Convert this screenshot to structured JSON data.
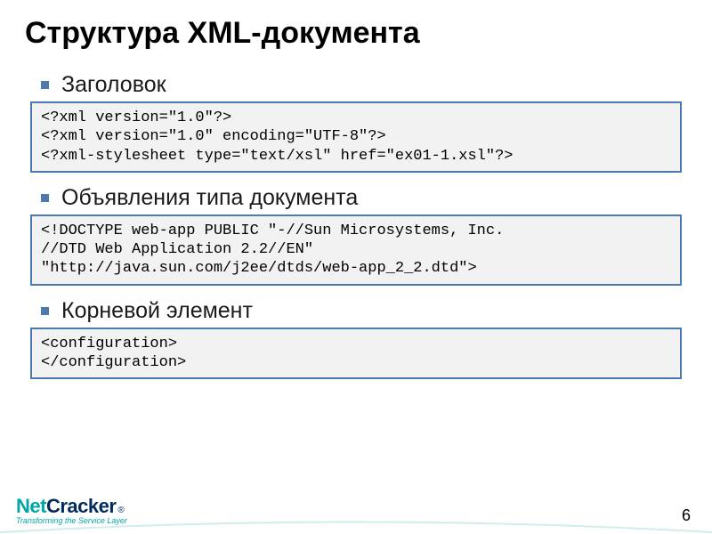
{
  "title": "Структура XML-документа",
  "sections": [
    {
      "label": "Заголовок",
      "code": "<?xml version=\"1.0\"?>\n<?xml version=\"1.0\" encoding=\"UTF-8\"?>\n<?xml-stylesheet type=\"text/xsl\" href=\"ex01-1.xsl\"?>"
    },
    {
      "label": "Объявления типа документа",
      "code": "<!DOCTYPE web-app PUBLIC \"-//Sun Microsystems, Inc.\n//DTD Web Application 2.2//EN\"\n\"http://java.sun.com/j2ee/dtds/web-app_2_2.dtd\">"
    },
    {
      "label": "Корневой элемент",
      "code": "<configuration>\n</configuration>"
    }
  ],
  "footer": {
    "logo_net": "Net",
    "logo_cracker": "Cracker",
    "logo_reg": "®",
    "tagline": "Transforming the Service Layer",
    "page": "6"
  }
}
